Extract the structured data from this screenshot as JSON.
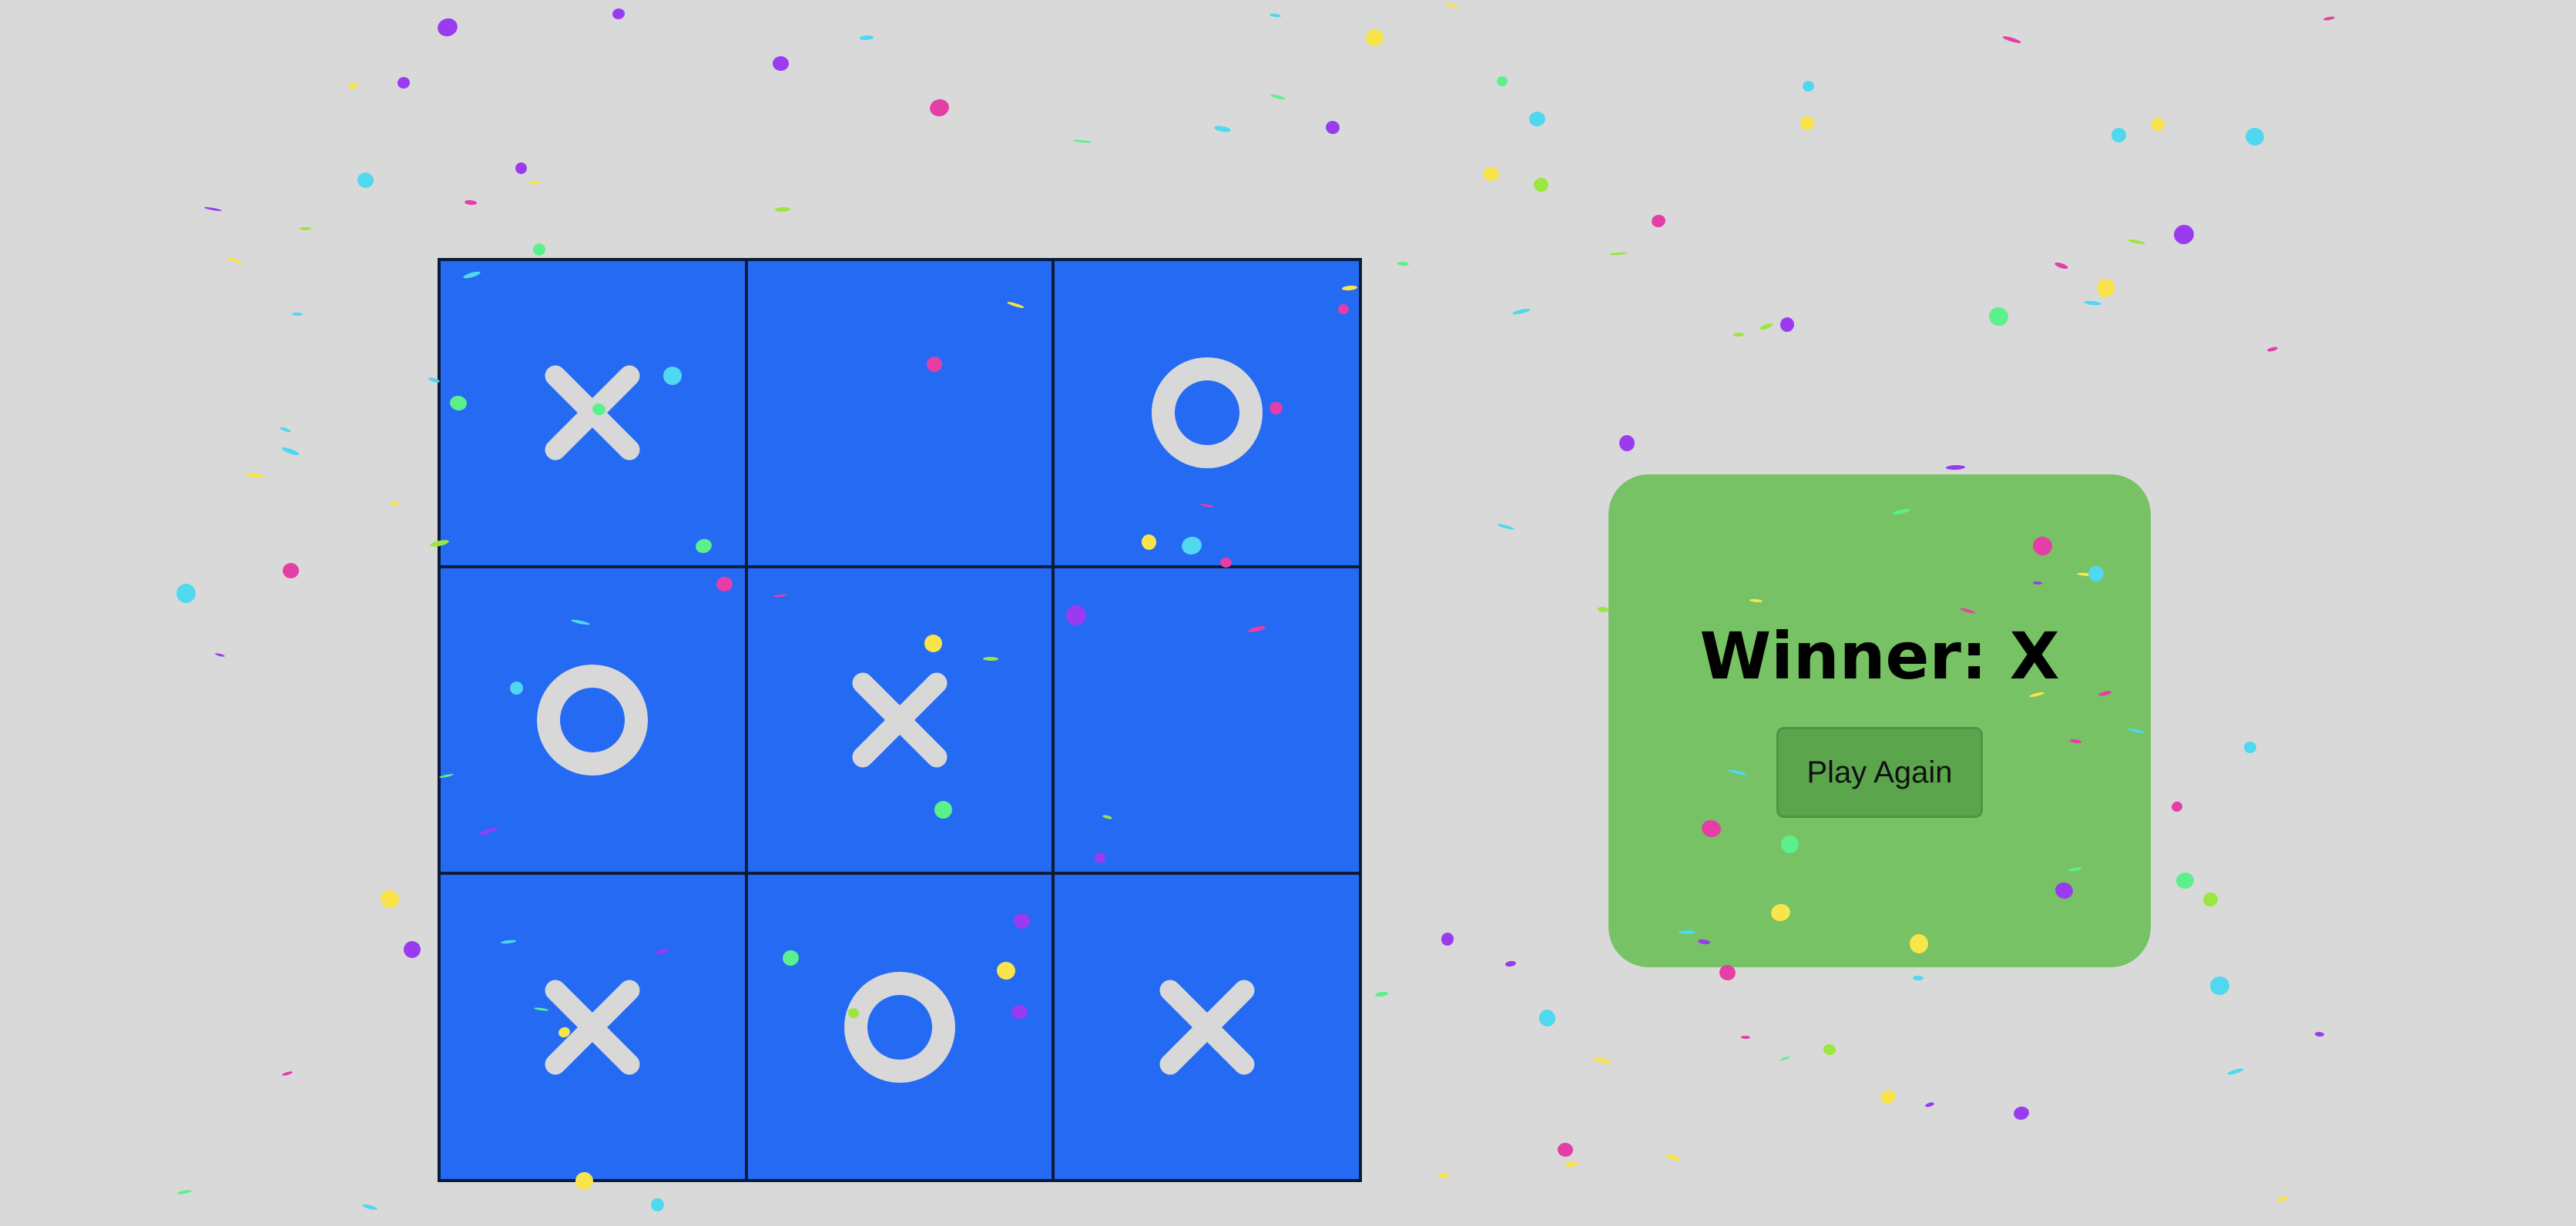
{
  "board": {
    "cells": [
      {
        "mark": "X",
        "mark_icon": "x-mark-icon"
      },
      {
        "mark": "",
        "mark_icon": ""
      },
      {
        "mark": "O",
        "mark_icon": "o-mark-icon"
      },
      {
        "mark": "O",
        "mark_icon": "o-mark-icon"
      },
      {
        "mark": "X",
        "mark_icon": "x-mark-icon"
      },
      {
        "mark": "",
        "mark_icon": ""
      },
      {
        "mark": "X",
        "mark_icon": "x-mark-icon"
      },
      {
        "mark": "O",
        "mark_icon": "o-mark-icon"
      },
      {
        "mark": "X",
        "mark_icon": "x-mark-icon"
      }
    ],
    "mark_color": "#d8d8d8",
    "cell_color": "#256af3",
    "grid_line_color": "#0b1b3a"
  },
  "result_panel": {
    "title": "Winner: X",
    "play_again_label": "Play Again",
    "panel_color": "#77c264",
    "button_color": "#5ba54c"
  },
  "confetti": {
    "colors": [
      "#e53ea7",
      "#f9e44b",
      "#4fd8ef",
      "#5cf08c",
      "#9a3bf0",
      "#9be63f"
    ]
  },
  "page": {
    "background_color": "#d9d9d9"
  }
}
